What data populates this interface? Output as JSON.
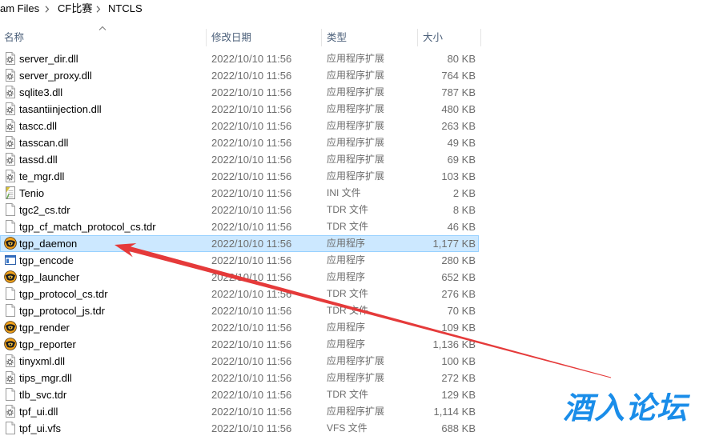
{
  "breadcrumb": {
    "items": [
      {
        "label": "am Files"
      },
      {
        "label": "CF比赛"
      },
      {
        "label": "NTCLS"
      }
    ],
    "separator_icon": "chevron-right-icon"
  },
  "columns": [
    {
      "key": "name",
      "label": "名称",
      "sort_icon": "sort-ascending-icon"
    },
    {
      "key": "date",
      "label": "修改日期"
    },
    {
      "key": "type",
      "label": "类型"
    },
    {
      "key": "size",
      "label": "大小"
    }
  ],
  "files": [
    {
      "name": "server_dir.dll",
      "date": "2022/10/10 11:56",
      "type": "应用程序扩展",
      "size": "80 KB",
      "icon": "dll-file-icon"
    },
    {
      "name": "server_proxy.dll",
      "date": "2022/10/10 11:56",
      "type": "应用程序扩展",
      "size": "764 KB",
      "icon": "dll-file-icon"
    },
    {
      "name": "sqlite3.dll",
      "date": "2022/10/10 11:56",
      "type": "应用程序扩展",
      "size": "787 KB",
      "icon": "dll-file-icon"
    },
    {
      "name": "tasantiinjection.dll",
      "date": "2022/10/10 11:56",
      "type": "应用程序扩展",
      "size": "480 KB",
      "icon": "dll-file-icon"
    },
    {
      "name": "tascc.dll",
      "date": "2022/10/10 11:56",
      "type": "应用程序扩展",
      "size": "263 KB",
      "icon": "dll-file-icon"
    },
    {
      "name": "tasscan.dll",
      "date": "2022/10/10 11:56",
      "type": "应用程序扩展",
      "size": "49 KB",
      "icon": "dll-file-icon"
    },
    {
      "name": "tassd.dll",
      "date": "2022/10/10 11:56",
      "type": "应用程序扩展",
      "size": "69 KB",
      "icon": "dll-file-icon"
    },
    {
      "name": "te_mgr.dll",
      "date": "2022/10/10 11:56",
      "type": "应用程序扩展",
      "size": "103 KB",
      "icon": "dll-file-icon"
    },
    {
      "name": "Tenio",
      "date": "2022/10/10 11:56",
      "type": "INI 文件",
      "size": "2 KB",
      "icon": "ini-file-icon"
    },
    {
      "name": "tgc2_cs.tdr",
      "date": "2022/10/10 11:56",
      "type": "TDR 文件",
      "size": "8 KB",
      "icon": "blank-file-icon"
    },
    {
      "name": "tgp_cf_match_protocol_cs.tdr",
      "date": "2022/10/10 11:56",
      "type": "TDR 文件",
      "size": "46 KB",
      "icon": "blank-file-icon"
    },
    {
      "name": "tgp_daemon",
      "date": "2022/10/10 11:56",
      "type": "应用程序",
      "size": "1,177 KB",
      "icon": "cf-game-app-icon",
      "selected": true
    },
    {
      "name": "tgp_encode",
      "date": "2022/10/10 11:56",
      "type": "应用程序",
      "size": "280 KB",
      "icon": "app-window-icon"
    },
    {
      "name": "tgp_launcher",
      "date": "2022/10/10 11:56",
      "type": "应用程序",
      "size": "652 KB",
      "icon": "cf-game-app-icon"
    },
    {
      "name": "tgp_protocol_cs.tdr",
      "date": "2022/10/10 11:56",
      "type": "TDR 文件",
      "size": "276 KB",
      "icon": "blank-file-icon"
    },
    {
      "name": "tgp_protocol_js.tdr",
      "date": "2022/10/10 11:56",
      "type": "TDR 文件",
      "size": "70 KB",
      "icon": "blank-file-icon"
    },
    {
      "name": "tgp_render",
      "date": "2022/10/10 11:56",
      "type": "应用程序",
      "size": "109 KB",
      "icon": "cf-game-app-icon"
    },
    {
      "name": "tgp_reporter",
      "date": "2022/10/10 11:56",
      "type": "应用程序",
      "size": "1,136 KB",
      "icon": "cf-game-app-icon"
    },
    {
      "name": "tinyxml.dll",
      "date": "2022/10/10 11:56",
      "type": "应用程序扩展",
      "size": "100 KB",
      "icon": "dll-file-icon"
    },
    {
      "name": "tips_mgr.dll",
      "date": "2022/10/10 11:56",
      "type": "应用程序扩展",
      "size": "272 KB",
      "icon": "dll-file-icon"
    },
    {
      "name": "tlb_svc.tdr",
      "date": "2022/10/10 11:56",
      "type": "TDR 文件",
      "size": "129 KB",
      "icon": "blank-file-icon"
    },
    {
      "name": "tpf_ui.dll",
      "date": "2022/10/10 11:56",
      "type": "应用程序扩展",
      "size": "1,114 KB",
      "icon": "dll-file-icon"
    },
    {
      "name": "tpf_ui.vfs",
      "date": "2022/10/10 11:56",
      "type": "VFS 文件",
      "size": "688 KB",
      "icon": "blank-file-icon"
    }
  ],
  "annotation": {
    "arrow_color": "#e53a3a",
    "arrow_target": "tgp_daemon"
  },
  "watermark": {
    "text": "酒入论坛",
    "color": "#1a8de9"
  },
  "colors": {
    "selection_fill": "#cce8ff",
    "selection_border": "#99d1ff",
    "secondary_text": "#6d6d6d",
    "header_text": "#4c607a",
    "column_separator": "#e5e5e5"
  }
}
